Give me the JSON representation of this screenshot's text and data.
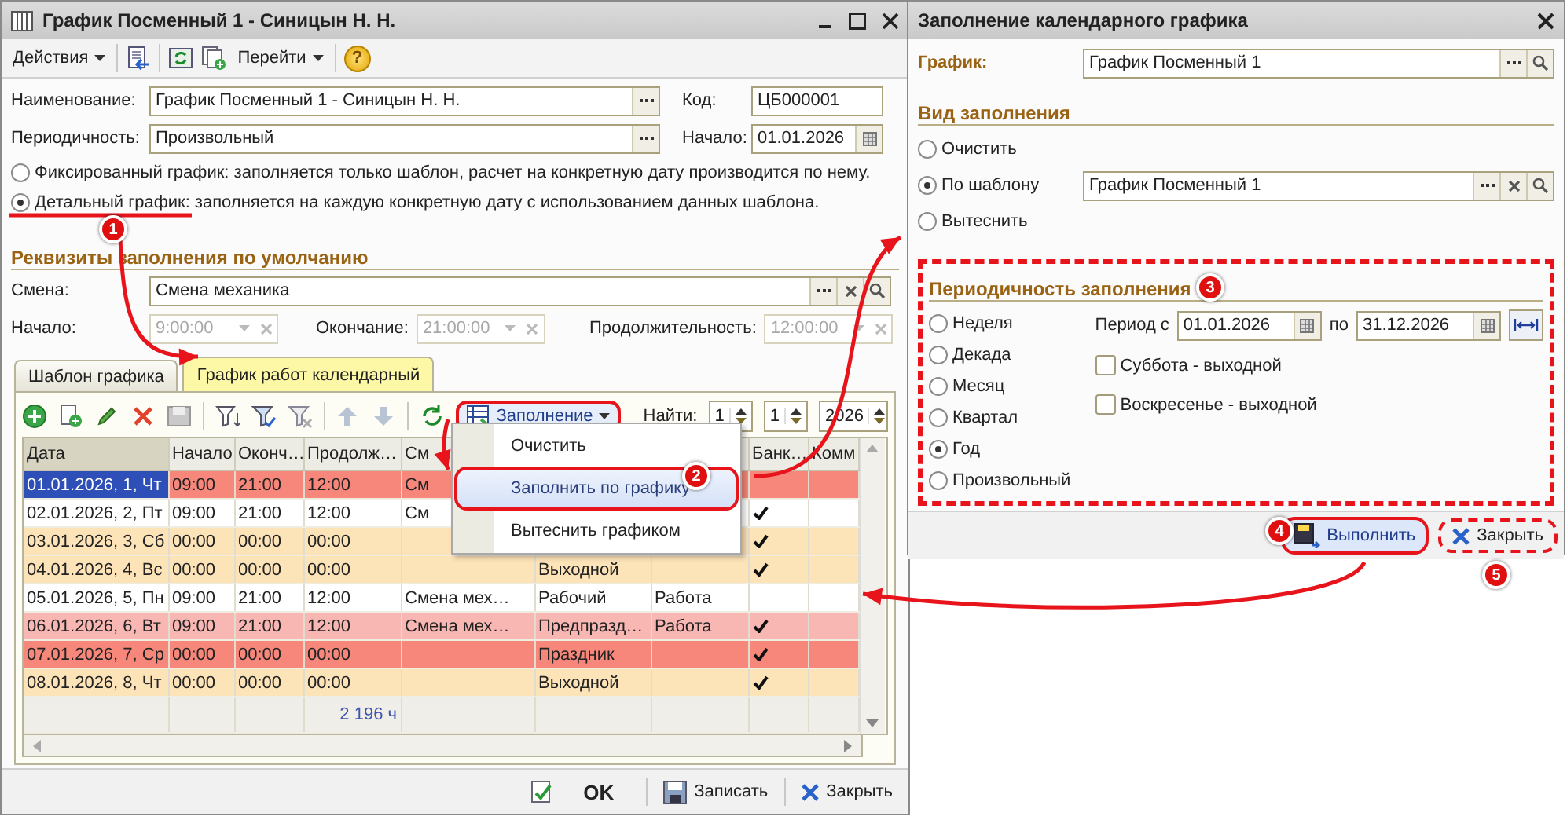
{
  "main_window": {
    "title": "График Посменный 1 - Синицын Н. Н.",
    "toolbar": {
      "actions_menu": "Действия",
      "goto_menu": "Перейти",
      "help": "?"
    },
    "name_label": "Наименование:",
    "name_value": "График Посменный 1 - Синицын Н. Н.",
    "code_label": "Код:",
    "code_value": "ЦБ000001",
    "period_label": "Периодичность:",
    "period_value": "Произвольный",
    "start_label": "Начало:",
    "start_value": "01.01.2026",
    "mode_options": [
      {
        "label": "Фиксированный график: заполняется только шаблон, расчет на конкретную дату производится по нему.",
        "selected": false
      },
      {
        "label": "Детальный график: заполняется на каждую конкретную дату с использованием данных шаблона.",
        "selected": true
      }
    ],
    "defaults_heading": "Реквизиты заполнения по умолчанию",
    "shift_label": "Смена:",
    "shift_value": "Смена механика",
    "times": [
      {
        "label": "Начало:",
        "value": "9:00:00",
        "disabled": true
      },
      {
        "label": "Окончание:",
        "value": "21:00:00",
        "disabled": true
      },
      {
        "label": "Продолжительность:",
        "value": "12:00:00",
        "disabled": true
      }
    ],
    "tabs": [
      {
        "label": "Шаблон графика",
        "selected": false
      },
      {
        "label": "График работ календарный",
        "selected": true
      }
    ],
    "table_toolbar": {
      "fill_button": "Заполнение",
      "find_label": "Найти:",
      "find_values": [
        "1",
        "1",
        "2026"
      ]
    },
    "fill_menu": [
      {
        "label": "Очистить",
        "highlighted": false
      },
      {
        "label": "Заполнить по графику",
        "highlighted": true
      },
      {
        "label": "Вытеснить графиком",
        "highlighted": false
      }
    ],
    "table": {
      "columns": [
        {
          "label": "Дата"
        },
        {
          "label": "Начало"
        },
        {
          "label": "Оконч…"
        },
        {
          "label": "Продолж…"
        },
        {
          "label": "См"
        },
        {},
        {},
        {
          "label": "Банк…"
        },
        {
          "label": "Комм"
        }
      ],
      "rows": [
        {
          "date": "01.01.2026, 1, Чт",
          "start": "09:00",
          "end": "21:00",
          "duration": "12:00",
          "shift": "См",
          "bank": false,
          "selected": true,
          "color": "#f6877a"
        },
        {
          "date": "02.01.2026, 2, Пт",
          "start": "09:00",
          "end": "21:00",
          "duration": "12:00",
          "shift": "См",
          "bank": true,
          "selected": false,
          "color": "#ffffff"
        },
        {
          "date": "03.01.2026, 3, Сб",
          "start": "00:00",
          "end": "00:00",
          "duration": "00:00",
          "bank": true,
          "selected": false,
          "color": "#fde3b8"
        },
        {
          "date": "04.01.2026, 4, Вс",
          "start": "00:00",
          "end": "00:00",
          "duration": "00:00",
          "day_type": "Выходной",
          "bank": true,
          "selected": false,
          "color": "#fde3b8"
        },
        {
          "date": "05.01.2026, 5, Пн",
          "start": "09:00",
          "end": "21:00",
          "duration": "12:00",
          "shift": "Смена мех…",
          "day_type": "Рабочий",
          "work_type": "Работа",
          "bank": false,
          "selected": false,
          "color": "#ffffff"
        },
        {
          "date": "06.01.2026, 6, Вт",
          "start": "09:00",
          "end": "21:00",
          "duration": "12:00",
          "shift": "Смена мех…",
          "day_type": "Предпразд…",
          "work_type": "Работа",
          "bank": true,
          "selected": false,
          "color": "#f8b7b2"
        },
        {
          "date": "07.01.2026, 7, Ср",
          "start": "00:00",
          "end": "00:00",
          "duration": "00:00",
          "day_type": "Праздник",
          "bank": true,
          "selected": false,
          "color": "#f6877a"
        },
        {
          "date": "08.01.2026, 8, Чт",
          "start": "00:00",
          "end": "00:00",
          "duration": "00:00",
          "day_type": "Выходной",
          "bank": true,
          "selected": false,
          "color": "#fde3b8"
        }
      ],
      "total_duration": "2 196 ч"
    },
    "buttons": {
      "ok": "OK",
      "save": "Записать",
      "close": "Закрыть"
    }
  },
  "fill_dialog": {
    "title": "Заполнение календарного графика",
    "schedule_label": "График:",
    "schedule_value": "График Посменный 1",
    "fill_kind_heading": "Вид заполнения",
    "fill_kinds": [
      {
        "label": "Очистить",
        "selected": false
      },
      {
        "label": "По шаблону",
        "selected": true,
        "value": "График Посменный 1"
      },
      {
        "label": "Вытеснить",
        "selected": false
      }
    ],
    "periodicity_heading": "Периодичность заполнения",
    "periodicities": [
      {
        "label": "Неделя",
        "selected": false
      },
      {
        "label": "Декада",
        "selected": false
      },
      {
        "label": "Месяц",
        "selected": false
      },
      {
        "label": "Квартал",
        "selected": false
      },
      {
        "label": "Год",
        "selected": true
      },
      {
        "label": "Произвольный",
        "selected": false
      }
    ],
    "period_from_label": "Период с",
    "period_from": "01.01.2026",
    "period_to_label": "по",
    "period_to": "31.12.2026",
    "weekend_options": [
      {
        "label": "Суббота - выходной",
        "checked": false
      },
      {
        "label": "Воскресенье - выходной",
        "checked": false
      }
    ],
    "buttons": {
      "run": "Выполнить",
      "close": "Закрыть"
    }
  },
  "annotations": [
    {
      "number": "1"
    },
    {
      "number": "2"
    },
    {
      "number": "3"
    },
    {
      "number": "4"
    },
    {
      "number": "5"
    }
  ]
}
